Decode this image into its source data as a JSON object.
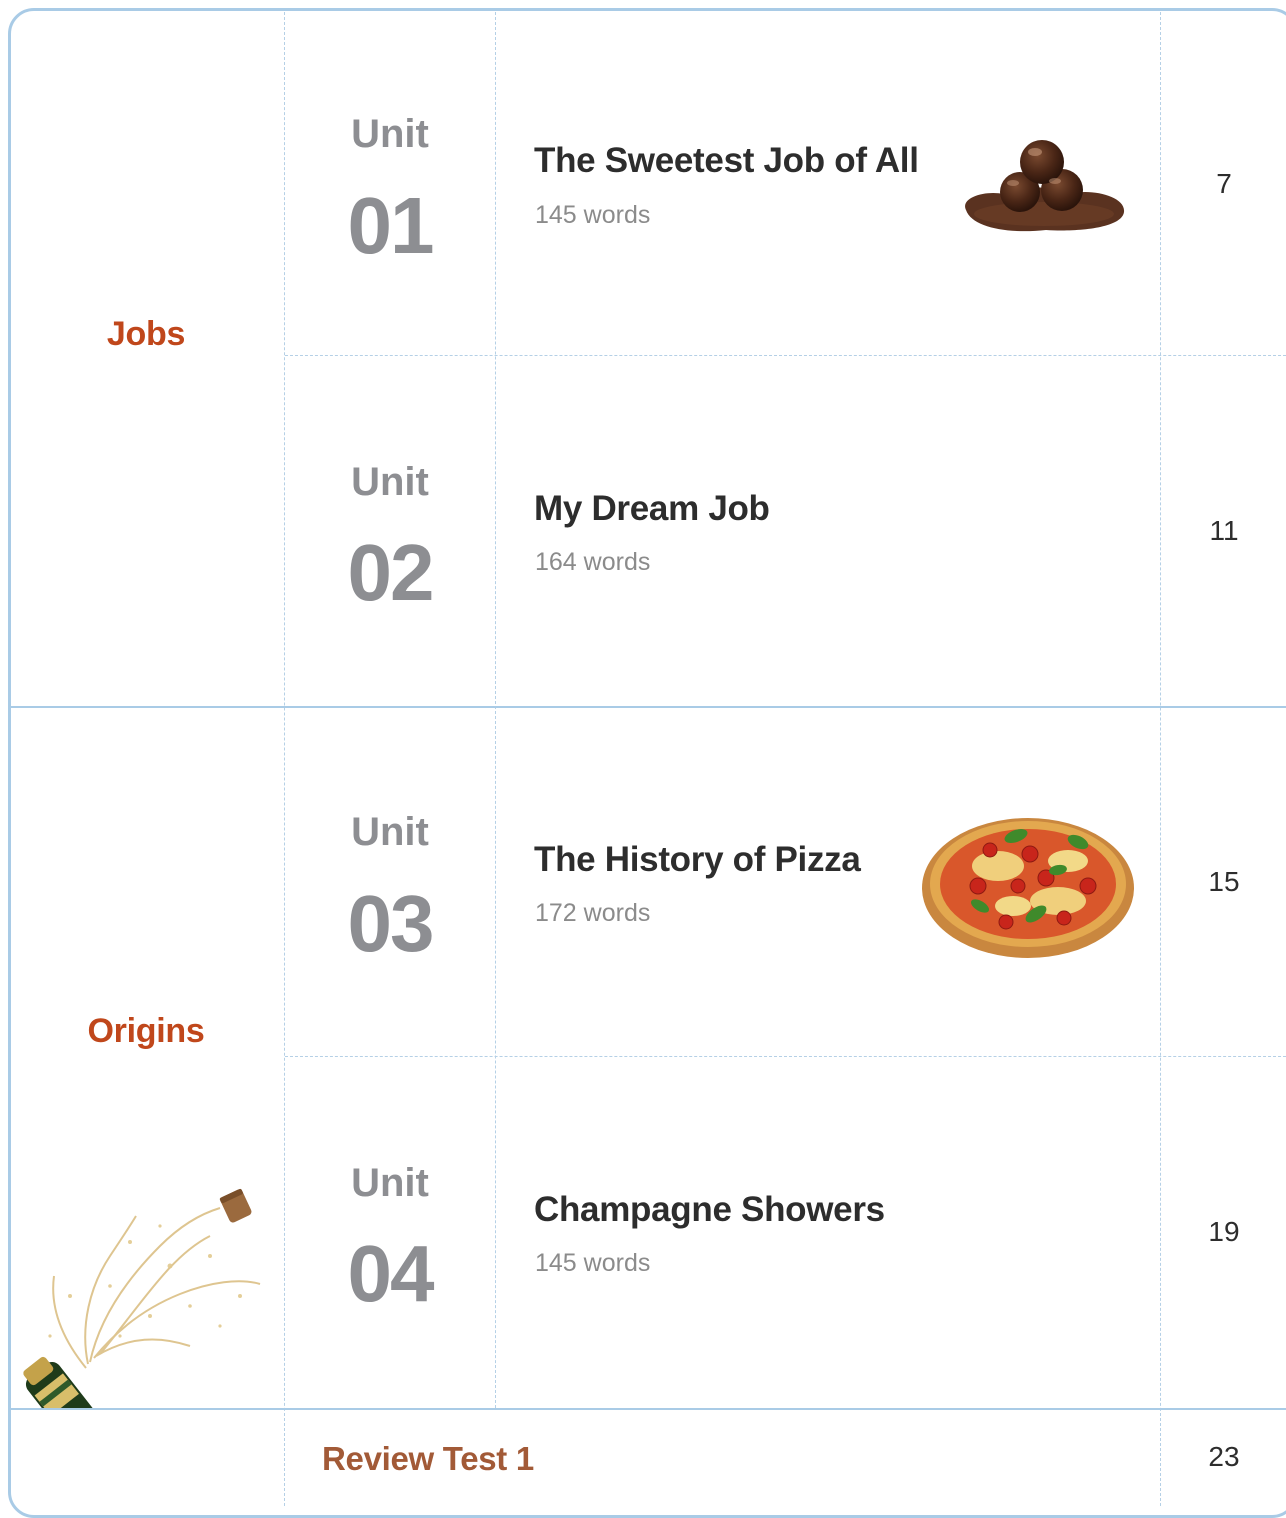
{
  "sections": [
    {
      "label": "Jobs"
    },
    {
      "label": "Origins"
    }
  ],
  "units": [
    {
      "unit_word": "Unit",
      "number": "01",
      "title": "The Sweetest Job of All",
      "words": "145 words",
      "page": "7",
      "image_icon": "chocolate-truffles-image"
    },
    {
      "unit_word": "Unit",
      "number": "02",
      "title": "My Dream Job",
      "words": "164 words",
      "page": "11"
    },
    {
      "unit_word": "Unit",
      "number": "03",
      "title": "The History of Pizza",
      "words": "172 words",
      "page": "15",
      "image_icon": "pizza-image"
    },
    {
      "unit_word": "Unit",
      "number": "04",
      "title": "Champagne Showers",
      "words": "145 words",
      "page": "19"
    }
  ],
  "review": {
    "label": "Review Test 1",
    "page": "23"
  },
  "decor": {
    "champagne_image": "champagne-bottle-image"
  },
  "colors": {
    "section_label": "#c0471b",
    "review_label": "#a25a37",
    "unit_number": "#8d8e92",
    "border": "#a9cbe6"
  }
}
